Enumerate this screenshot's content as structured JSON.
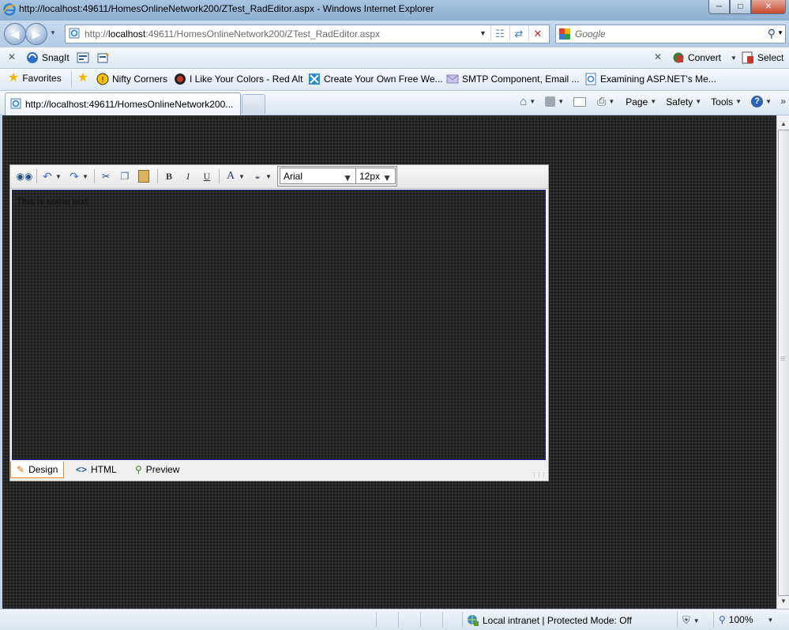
{
  "window": {
    "title": "http://localhost:49611/HomesOnlineNetwork200/ZTest_RadEditor.aspx - Windows Internet Explorer",
    "controls": [
      "minimize",
      "maximize",
      "close"
    ]
  },
  "address_bar": {
    "url_prefix": "http://",
    "url_host": "localhost",
    "url_rest": ":49611/HomesOnlineNetwork200/ZTest_RadEditor.aspx"
  },
  "search": {
    "placeholder": "Google"
  },
  "snagit_toolbar": {
    "snagit_label": "SnagIt",
    "convert_label": "Convert",
    "select_label": "Select"
  },
  "favorites_bar": {
    "favorites_label": "Favorites",
    "links": [
      "Nifty Corners",
      "I Like Your Colors - Red Alt",
      "Create Your Own Free We...",
      "SMTP Component, Email ...",
      "Examining ASP.NET's Me..."
    ]
  },
  "tabs": {
    "active_title": "http://localhost:49611/HomesOnlineNetwork200..."
  },
  "command_bar": {
    "page_label": "Page",
    "safety_label": "Safety",
    "tools_label": "Tools"
  },
  "editor": {
    "font_name": "Arial",
    "font_size": "12px",
    "content_text": "This is some text",
    "modes": [
      "Design",
      "HTML",
      "Preview"
    ],
    "active_mode": "Design"
  },
  "status_bar": {
    "zone_text": "Local intranet | Protected Mode: Off",
    "zoom": "100%"
  }
}
